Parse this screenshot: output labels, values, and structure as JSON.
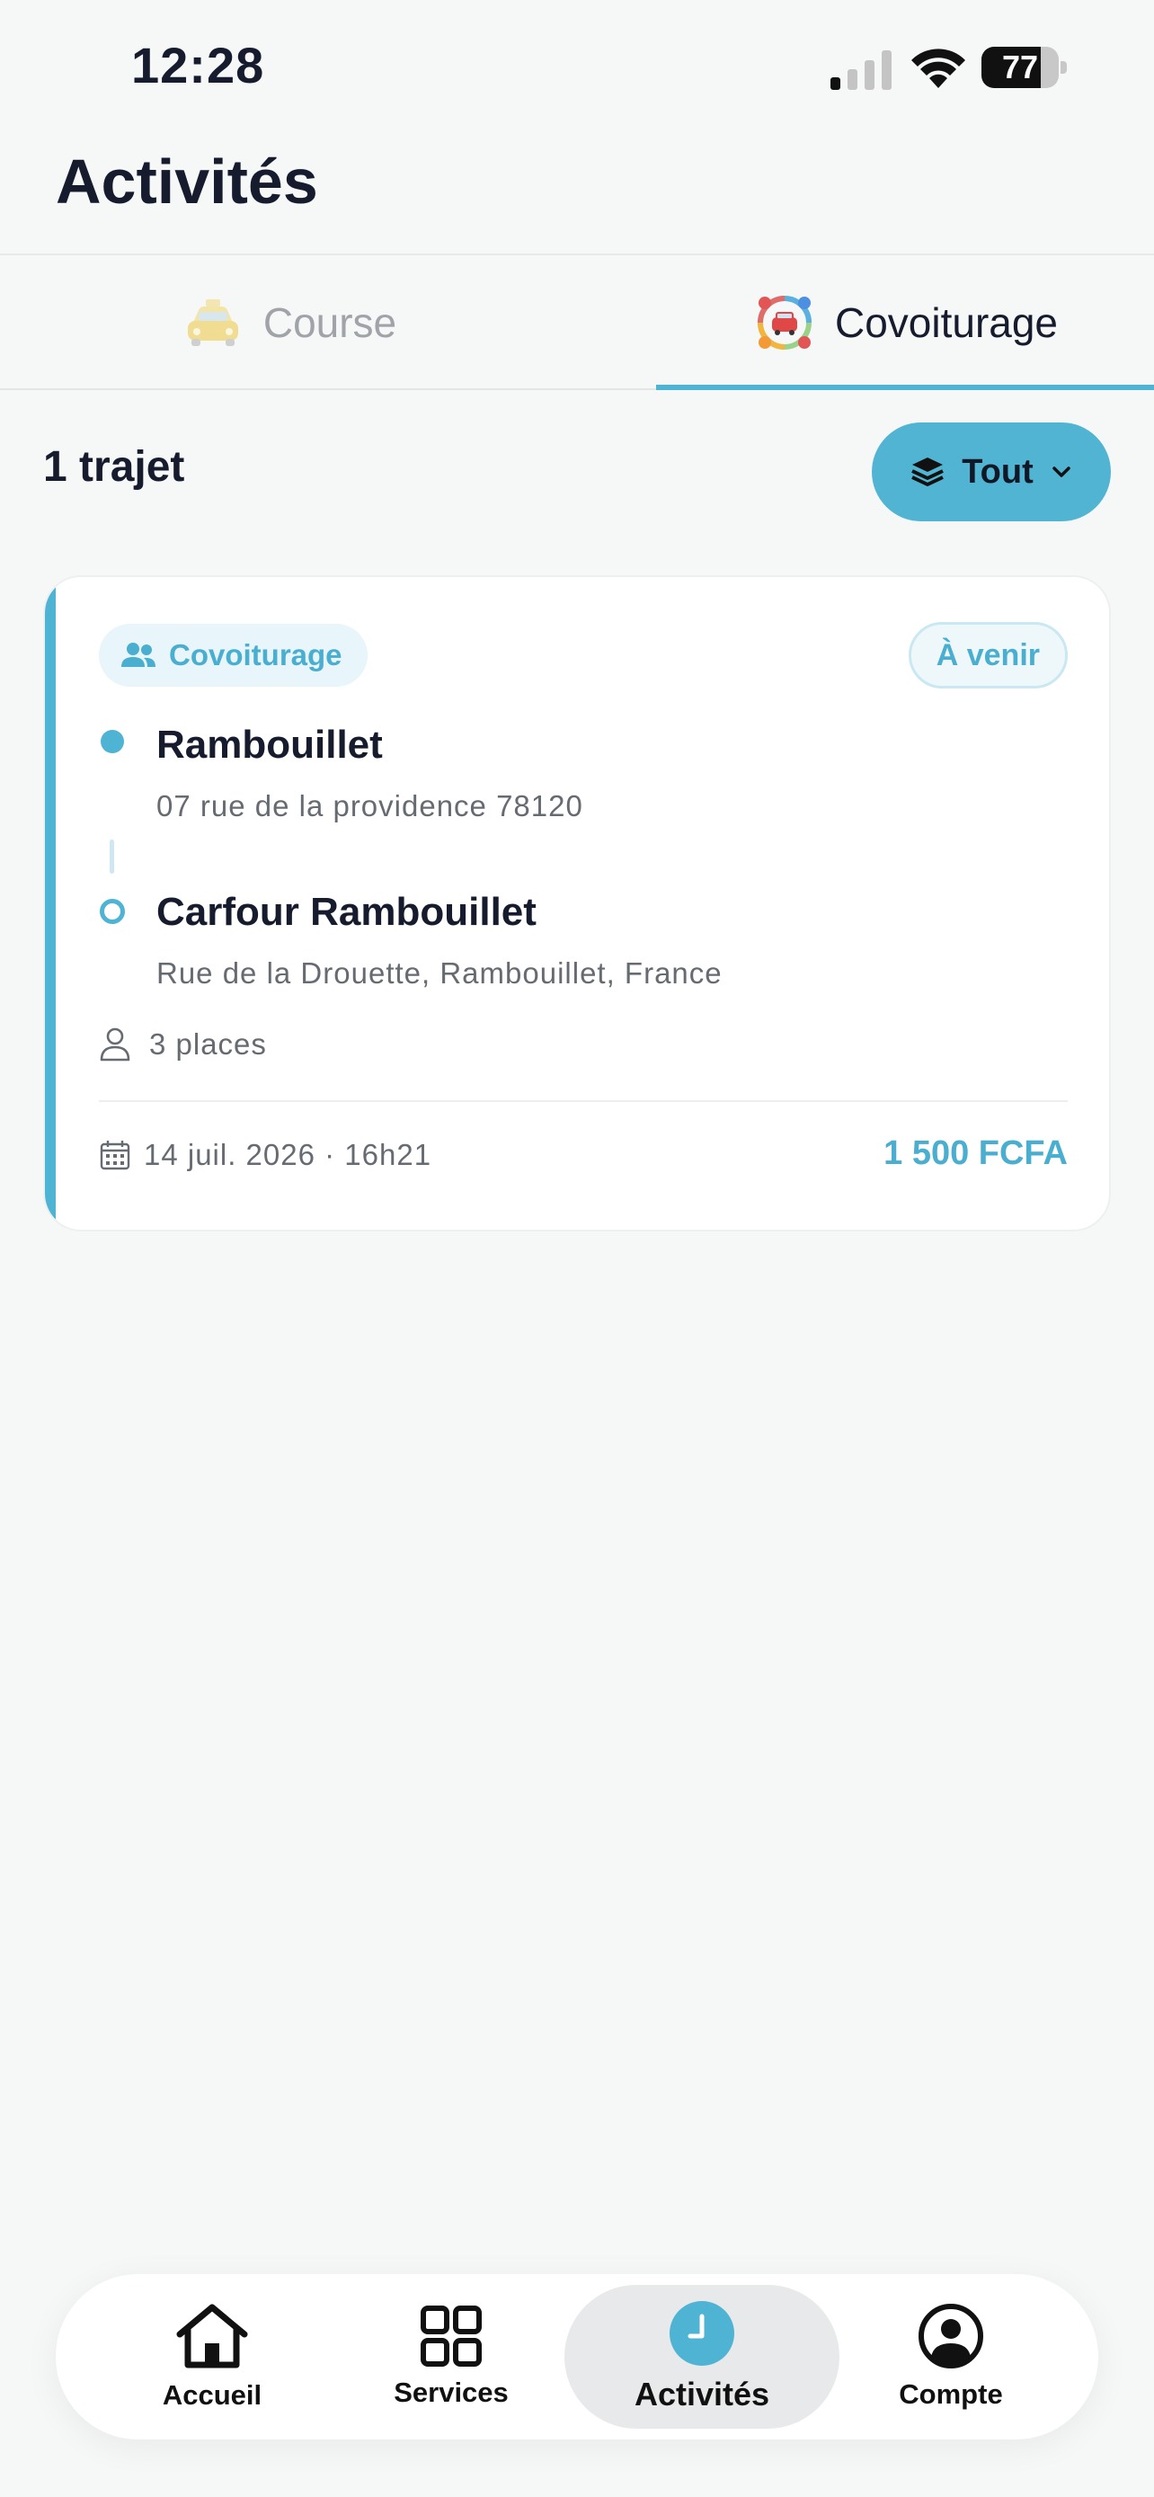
{
  "status_bar": {
    "time": "12:28",
    "battery_percent": "77",
    "battery_level": 0.77
  },
  "header": {
    "title": "Activités"
  },
  "tabs": [
    {
      "label": "Course",
      "active": false,
      "icon": "taxi-icon"
    },
    {
      "label": "Covoiturage",
      "active": true,
      "icon": "carpool-icon"
    }
  ],
  "list": {
    "count_label": "1 trajet",
    "filter_label": "Tout"
  },
  "trip": {
    "type_label": "Covoiturage",
    "status_label": "À venir",
    "from": {
      "name": "Rambouillet",
      "address": "07 rue de la providence 78120"
    },
    "to": {
      "name": "Carfour Rambouillet",
      "address": "Rue de la Drouette, Rambouillet, France"
    },
    "seats_label": "3 places",
    "date_label": "14 juil. 2026 · 16h21",
    "price_label": "1 500 FCFA"
  },
  "nav": {
    "items": [
      {
        "label": "Accueil",
        "icon": "home-icon"
      },
      {
        "label": "Services",
        "icon": "grid-icon"
      },
      {
        "label": "Activités",
        "icon": "clock-icon",
        "active": true
      },
      {
        "label": "Compte",
        "icon": "user-circle-icon"
      }
    ]
  },
  "colors": {
    "accent": "#4fb3d3",
    "text": "#161b2e",
    "muted": "#666b72",
    "background": "#f6f8f8"
  }
}
